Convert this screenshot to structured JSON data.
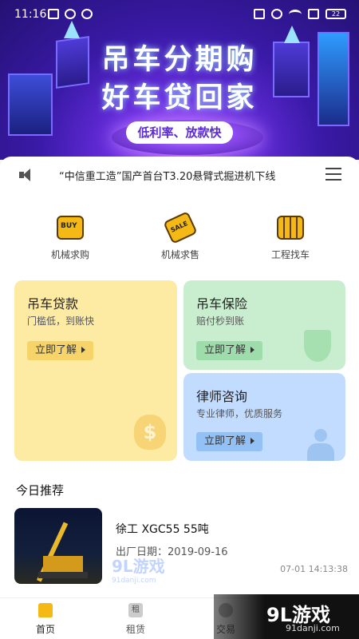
{
  "status_bar": {
    "time": "11:16",
    "battery": "22"
  },
  "banner": {
    "title_line1": "吊车分期购",
    "title_line2": "好车贷回家",
    "pill": "低利率、放款快"
  },
  "notice": {
    "text": "“中信重工造”国产首台T3.20悬臂式掘进机下线"
  },
  "quick_actions": [
    {
      "label": "机械求购",
      "icon": "buy-icon",
      "icon_text": "BUY"
    },
    {
      "label": "机械求售",
      "icon": "sale-icon",
      "icon_text": "SALE"
    },
    {
      "label": "工程找车",
      "icon": "engineering-icon",
      "icon_text": ""
    }
  ],
  "cards": {
    "loan": {
      "title": "吊车贷款",
      "subtitle": "门槛低，到账快",
      "button": "立即了解",
      "color": "#fdeaa3"
    },
    "insurance": {
      "title": "吊车保险",
      "subtitle": "赔付秒到账",
      "button": "立即了解",
      "color": "#c9eecf"
    },
    "lawyer": {
      "title": "律师咨询",
      "subtitle": "专业律师，优质服务",
      "button": "立即了解",
      "color": "#c2dcff"
    }
  },
  "recommend": {
    "section_title": "今日推荐",
    "items": [
      {
        "name": "徐工 XGC55 55吨",
        "date": "出厂日期：2019-09-16",
        "time": "07-01 14:13:38"
      }
    ]
  },
  "tabbar": {
    "tabs": [
      {
        "label": "首页",
        "icon_text": ""
      },
      {
        "label": "租赁",
        "icon_text": "租"
      },
      {
        "label": "交易",
        "icon_text": ""
      }
    ]
  },
  "watermarks": {
    "center_big": "9L游戏",
    "center_small": "91danji.com",
    "corner_big": "9L游戏",
    "corner_small": "91danji.com"
  },
  "colors": {
    "accent": "#f5b916",
    "banner": "#3a1aa8"
  }
}
